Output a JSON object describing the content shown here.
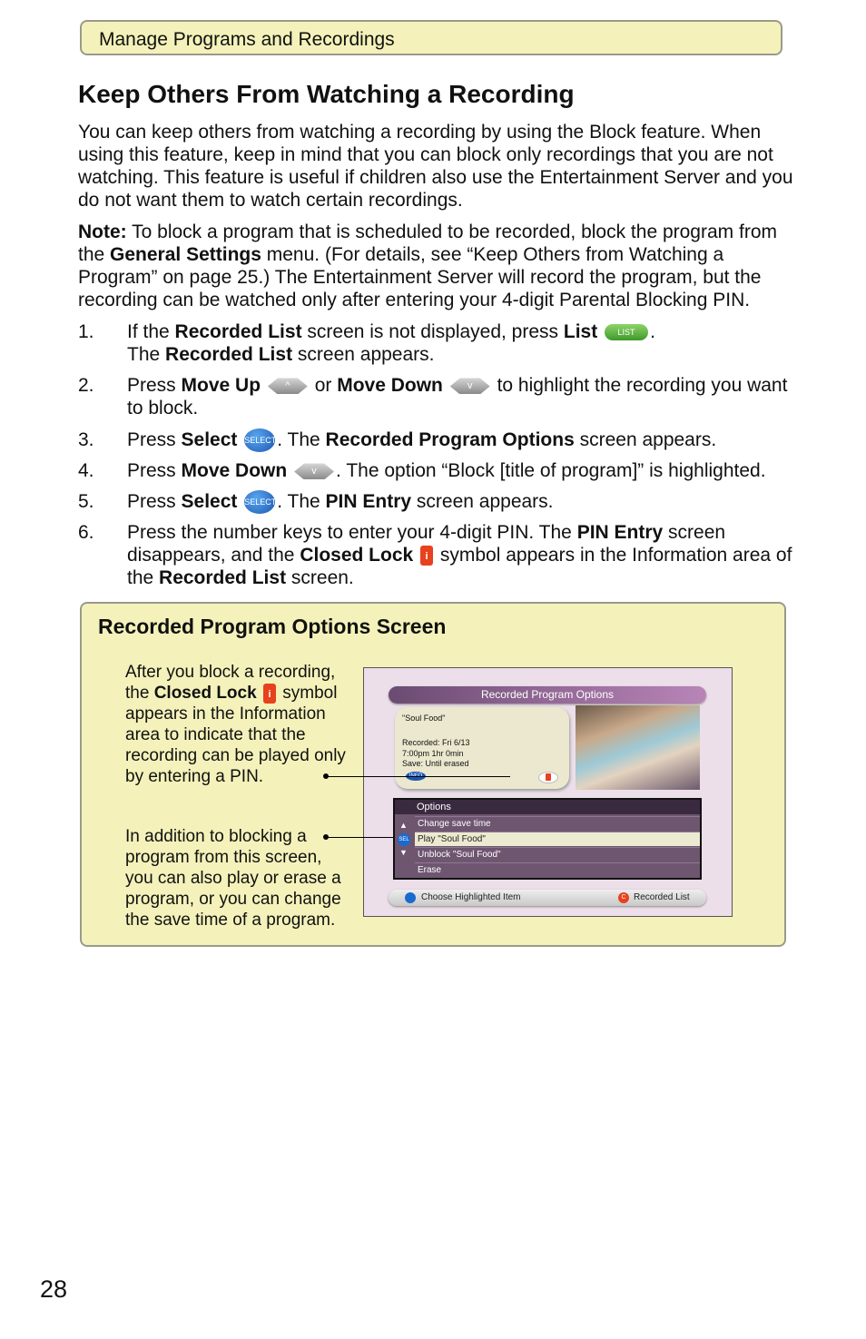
{
  "header": {
    "section": "Manage Programs and Recordings"
  },
  "title": "Keep Others From Watching a Recording",
  "intro": [
    {
      "t": "You can keep others from watching a recording by using the Block feature. When using this feature, keep in mind that you can block only recordings that you are not watching. This feature is useful if children also use the Entertainment Server and you do not want them to watch certain recordings."
    }
  ],
  "note": [
    {
      "t": "Note:",
      "b": true
    },
    {
      "t": " To block a program that is scheduled to be recorded, block the program from the "
    },
    {
      "t": "General Settings",
      "b": true
    },
    {
      "t": " menu. (For details, see “Keep Others from Watching a Program” on page 25.) The Entertainment Server will record the program, but the recording can be watched only after entering your 4-digit Parental Blocking PIN."
    }
  ],
  "steps": [
    {
      "num": "1.",
      "parts": [
        {
          "t": "If the "
        },
        {
          "t": "Recorded List",
          "b": true
        },
        {
          "t": " screen is not displayed, press "
        },
        {
          "t": "List",
          "b": true
        },
        {
          "t": " "
        },
        {
          "icon": "list-button-icon",
          "label": "LIST"
        },
        {
          "t": "."
        },
        {
          "br": true
        },
        {
          "t": "The "
        },
        {
          "t": "Recorded List",
          "b": true
        },
        {
          "t": " screen appears."
        }
      ]
    },
    {
      "num": "2.",
      "parts": [
        {
          "t": "Press "
        },
        {
          "t": "Move Up",
          "b": true
        },
        {
          "t": " "
        },
        {
          "icon": "move-up-button-icon",
          "label": "^"
        },
        {
          "t": " or "
        },
        {
          "t": "Move Down",
          "b": true
        },
        {
          "t": " "
        },
        {
          "icon": "move-down-button-icon",
          "label": "v"
        },
        {
          "t": " to highlight the recording you want to block."
        }
      ]
    },
    {
      "num": "3.",
      "parts": [
        {
          "t": "Press "
        },
        {
          "t": "Select",
          "b": true
        },
        {
          "t": " "
        },
        {
          "icon": "select-button-icon",
          "label": "SELECT"
        },
        {
          "t": ". The "
        },
        {
          "t": "Recorded Program Options",
          "b": true
        },
        {
          "t": " screen appears."
        }
      ]
    },
    {
      "num": "4.",
      "parts": [
        {
          "t": "Press "
        },
        {
          "t": "Move Down",
          "b": true
        },
        {
          "t": " "
        },
        {
          "icon": "move-down-button-icon",
          "label": "v"
        },
        {
          "t": ". The option “Block [title of program]” is highlighted."
        }
      ]
    },
    {
      "num": "5.",
      "parts": [
        {
          "t": "Press "
        },
        {
          "t": "Select",
          "b": true
        },
        {
          "t": " "
        },
        {
          "icon": "select-button-icon",
          "label": "SELECT"
        },
        {
          "t": ". The "
        },
        {
          "t": "PIN Entry",
          "b": true
        },
        {
          "t": " screen appears."
        }
      ]
    },
    {
      "num": "6.",
      "parts": [
        {
          "t": "Press the number keys to enter your 4-digit PIN. The "
        },
        {
          "t": "PIN Entry",
          "b": true
        },
        {
          "t": " screen disappears, and the "
        },
        {
          "t": "Closed Lock",
          "b": true
        },
        {
          "t": " "
        },
        {
          "icon": "closed-lock-icon",
          "label": "i"
        },
        {
          "t": " symbol appears in the Information area of the "
        },
        {
          "t": "Recorded List",
          "b": true
        },
        {
          "t": " screen."
        }
      ]
    }
  ],
  "callout": {
    "title": "Recorded Program Options Screen",
    "note1": [
      {
        "t": "After you block a recording, the "
      },
      {
        "t": "Closed Lock",
        "b": true
      },
      {
        "t": " "
      },
      {
        "icon": "closed-lock-icon",
        "label": "i"
      },
      {
        "t": " symbol appears in the Information area to indicate that the recording can be played only by entering a PIN."
      }
    ],
    "note2": [
      {
        "t": "In addition to blocking a program from this screen, you can also play or erase a program, or you can change the save time of a program."
      }
    ],
    "screen": {
      "title": "Recorded Program Options",
      "program": "\"Soul Food\"",
      "recorded": "Recorded: Fri  6/13",
      "time": "7:00pm  1hr  0min",
      "save": "Save: Until erased",
      "info_label": "INFO",
      "options_header": "Options",
      "options": [
        "Change save time",
        "Play \"Soul Food\"",
        "Unblock \"Soul Food\"",
        "Erase"
      ],
      "highlighted_index": 1,
      "sel_label": "SEL",
      "footer_left": "Choose Highlighted Item",
      "footer_right": "Recorded List",
      "footer_right_key": "C"
    }
  },
  "page_number": "28"
}
